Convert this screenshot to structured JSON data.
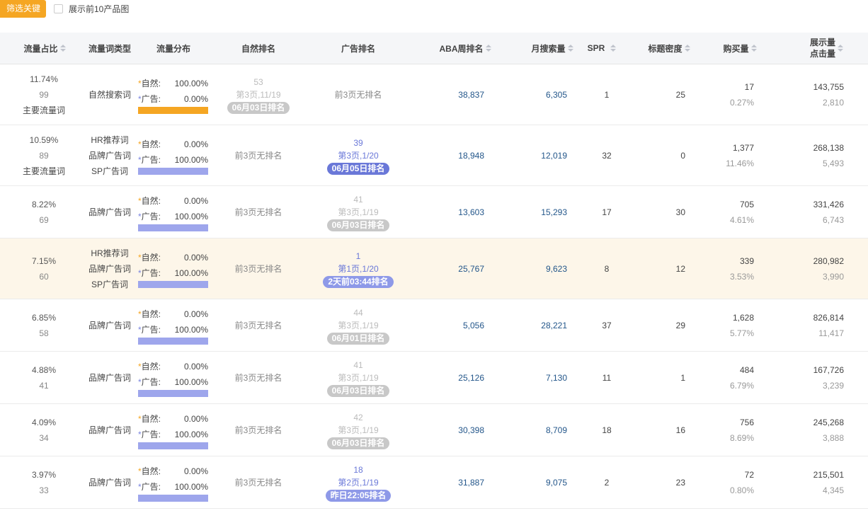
{
  "toolbar": {
    "filter_button": "筛选关键词",
    "top10_toggle": "展示前10产品图"
  },
  "columns": {
    "share": "流量占比",
    "type": "流量词类型",
    "dist": "流量分布",
    "natural": "自然排名",
    "ad": "广告排名",
    "aba": "ABA周排名",
    "search": "月搜索量",
    "spr": "SPR",
    "density": "标题密度",
    "buy": "购买量",
    "impr_top": "展示量",
    "impr_bottom": "点击量"
  },
  "labels": {
    "natural": "自然:",
    "ad": "广告:"
  },
  "colors": {
    "accent": "#f5a623",
    "natural_bar": "#f5a623",
    "ad_bar": "#9ea6ec",
    "highlight_row": "#fdf6e9",
    "number_blue": "#23568a"
  },
  "rows": [
    {
      "share": "11.74%",
      "count": "99",
      "tag": "主要流量词",
      "types": [
        "自然搜索词"
      ],
      "natural_pct": "100.00%",
      "ad_pct": "0.00%",
      "bar": "natural",
      "natural_rank": {
        "mode": "rank",
        "style": "muted",
        "pos": "53",
        "page": "第3页,11/19",
        "time": "06月03日排名"
      },
      "ad_rank": {
        "mode": "none",
        "text": "前3页无排名"
      },
      "aba": "38,837",
      "search": "6,305",
      "spr": "1",
      "density": "25",
      "buy": "17",
      "buy_pct": "0.27%",
      "impr": "143,755",
      "clicks": "2,810"
    },
    {
      "share": "10.59%",
      "count": "89",
      "tag": "主要流量词",
      "types": [
        "HR推荐词",
        "品牌广告词",
        "SP广告词"
      ],
      "natural_pct": "0.00%",
      "ad_pct": "100.00%",
      "bar": "ad",
      "natural_rank": {
        "mode": "none",
        "text": "前3页无排名"
      },
      "ad_rank": {
        "mode": "rank",
        "style": "blue",
        "pos": "39",
        "page": "第3页,1/20",
        "time": "06月05日排名"
      },
      "aba": "18,948",
      "search": "12,019",
      "spr": "32",
      "density": "0",
      "buy": "1,377",
      "buy_pct": "11.46%",
      "impr": "268,138",
      "clicks": "5,493"
    },
    {
      "share": "8.22%",
      "count": "69",
      "tag": "",
      "types": [
        "品牌广告词"
      ],
      "natural_pct": "0.00%",
      "ad_pct": "100.00%",
      "bar": "ad",
      "natural_rank": {
        "mode": "none",
        "text": "前3页无排名"
      },
      "ad_rank": {
        "mode": "rank",
        "style": "muted",
        "pos": "41",
        "page": "第3页,1/19",
        "time": "06月03日排名"
      },
      "aba": "13,603",
      "search": "15,293",
      "spr": "17",
      "density": "30",
      "buy": "705",
      "buy_pct": "4.61%",
      "impr": "331,426",
      "clicks": "6,743"
    },
    {
      "share": "7.15%",
      "count": "60",
      "tag": "",
      "types": [
        "HR推荐词",
        "品牌广告词",
        "SP广告词"
      ],
      "natural_pct": "0.00%",
      "ad_pct": "100.00%",
      "bar": "ad",
      "natural_rank": {
        "mode": "none",
        "text": "前3页无排名"
      },
      "ad_rank": {
        "mode": "rank",
        "style": "lblue",
        "pos": "1",
        "page": "第1页,1/20",
        "time": "2天前03:44排名"
      },
      "aba": "25,767",
      "search": "9,623",
      "spr": "8",
      "density": "12",
      "buy": "339",
      "buy_pct": "3.53%",
      "impr": "280,982",
      "clicks": "3,990"
    },
    {
      "share": "6.85%",
      "count": "58",
      "tag": "",
      "types": [
        "品牌广告词"
      ],
      "natural_pct": "0.00%",
      "ad_pct": "100.00%",
      "bar": "ad",
      "natural_rank": {
        "mode": "none",
        "text": "前3页无排名"
      },
      "ad_rank": {
        "mode": "rank",
        "style": "muted",
        "pos": "44",
        "page": "第3页,1/19",
        "time": "06月01日排名"
      },
      "aba": "5,056",
      "search": "28,221",
      "spr": "37",
      "density": "29",
      "buy": "1,628",
      "buy_pct": "5.77%",
      "impr": "826,814",
      "clicks": "11,417"
    },
    {
      "share": "4.88%",
      "count": "41",
      "tag": "",
      "types": [
        "品牌广告词"
      ],
      "natural_pct": "0.00%",
      "ad_pct": "100.00%",
      "bar": "ad",
      "natural_rank": {
        "mode": "none",
        "text": "前3页无排名"
      },
      "ad_rank": {
        "mode": "rank",
        "style": "muted",
        "pos": "41",
        "page": "第3页,1/19",
        "time": "06月03日排名"
      },
      "aba": "25,126",
      "search": "7,130",
      "spr": "11",
      "density": "1",
      "buy": "484",
      "buy_pct": "6.79%",
      "impr": "167,726",
      "clicks": "3,239"
    },
    {
      "share": "4.09%",
      "count": "34",
      "tag": "",
      "types": [
        "品牌广告词"
      ],
      "natural_pct": "0.00%",
      "ad_pct": "100.00%",
      "bar": "ad",
      "natural_rank": {
        "mode": "none",
        "text": "前3页无排名"
      },
      "ad_rank": {
        "mode": "rank",
        "style": "muted",
        "pos": "42",
        "page": "第3页,1/19",
        "time": "06月03日排名"
      },
      "aba": "30,398",
      "search": "8,709",
      "spr": "18",
      "density": "16",
      "buy": "756",
      "buy_pct": "8.69%",
      "impr": "245,268",
      "clicks": "3,888"
    },
    {
      "share": "3.97%",
      "count": "33",
      "tag": "",
      "types": [
        "品牌广告词"
      ],
      "natural_pct": "0.00%",
      "ad_pct": "100.00%",
      "bar": "ad",
      "natural_rank": {
        "mode": "none",
        "text": "前3页无排名"
      },
      "ad_rank": {
        "mode": "rank",
        "style": "lblue",
        "pos": "18",
        "page": "第2页,1/19",
        "time": "昨日22:05排名"
      },
      "aba": "31,887",
      "search": "9,075",
      "spr": "2",
      "density": "23",
      "buy": "72",
      "buy_pct": "0.80%",
      "impr": "215,501",
      "clicks": "4,345"
    }
  ]
}
